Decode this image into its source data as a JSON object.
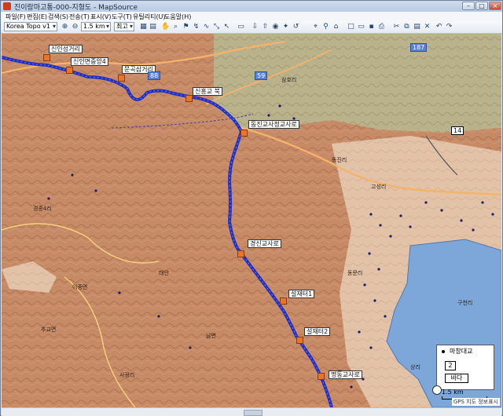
{
  "window": {
    "title": "진이랑마고통-000-지형도 - MapSource",
    "buttons": [
      "–",
      "□",
      "×"
    ]
  },
  "menu": [
    "파일(F)",
    "편집(E)",
    "검색(S)",
    "전송(T)",
    "표시(V)",
    "도구(T)",
    "유틸리티(U)",
    "도움말(H)"
  ],
  "toolbar": {
    "map_select": "Korea Topo v1",
    "zoom_select": "1.5 km",
    "detail_select": "최고"
  },
  "map": {
    "route_labels": [
      "신인성거리",
      "신인면중앙4",
      "문곡삼거리",
      "신흥교 북",
      "동진교사정교사로",
      "경신교사로",
      "설재터1",
      "설재터2",
      "명동교사로"
    ],
    "place_names": [
      "삼호리",
      "경종4리",
      "이중면",
      "태안",
      "남면",
      "동진리",
      "동문리",
      "구천리",
      "고성리",
      "상리",
      "추교면",
      "사광리"
    ],
    "road_badges": [
      "14",
      "59",
      "88",
      "187"
    ]
  },
  "legend": {
    "items": [
      "마창대교",
      "2",
      "바다"
    ]
  },
  "scale": "1.5 km",
  "status": "GPS 지도 정보표시"
}
